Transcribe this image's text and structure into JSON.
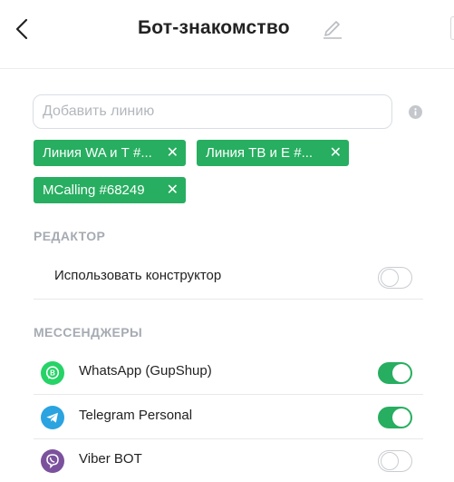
{
  "header": {
    "title": "Бот-знакомство",
    "back_icon": "chevron-left-icon",
    "edit_icon": "pencil-icon"
  },
  "lines": {
    "placeholder": "Добавить линию",
    "value": "",
    "info_icon": "info-icon",
    "chips": [
      {
        "label": "Линия WA и Т #..."
      },
      {
        "label": "Линия ТВ и Е #..."
      },
      {
        "label": "MCalling #68249"
      }
    ],
    "chip_color": "#27ae60"
  },
  "editor": {
    "title": "РЕДАКТОР",
    "items": [
      {
        "label": "Использовать конструктор",
        "enabled": false
      }
    ]
  },
  "messengers": {
    "title": "МЕССЕНДЖЕРЫ",
    "items": [
      {
        "label": "WhatsApp (GupShup)",
        "icon": "whatsapp-icon",
        "enabled": true,
        "color": "#25d366"
      },
      {
        "label": "Telegram Personal",
        "icon": "telegram-icon",
        "enabled": true,
        "color": "#2aa3e0"
      },
      {
        "label": "Viber BOT",
        "icon": "viber-icon",
        "enabled": false,
        "color": "#7b519d"
      }
    ]
  },
  "colors": {
    "toggle_on": "#27ae60",
    "section_title": "#a6abb3"
  }
}
